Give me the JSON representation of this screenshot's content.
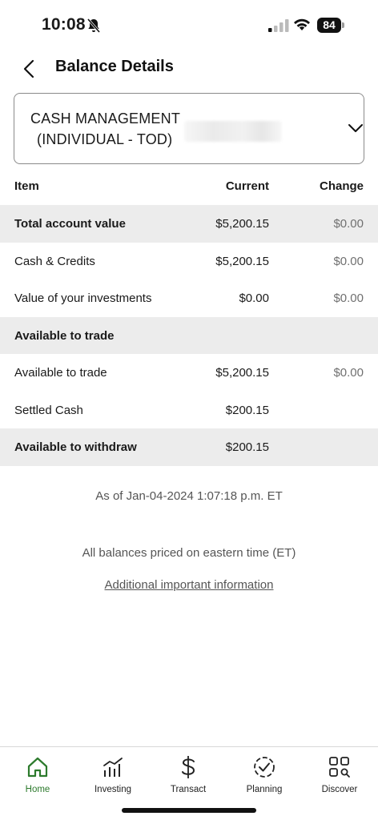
{
  "status_bar": {
    "time": "10:08",
    "battery": "84"
  },
  "header": {
    "title": "Balance Details"
  },
  "account": {
    "line1": "CASH MANAGEMENT",
    "line2": "(INDIVIDUAL - TOD)"
  },
  "table": {
    "headers": {
      "item": "Item",
      "current": "Current",
      "change": "Change"
    },
    "rows": [
      {
        "item": "Total account value",
        "current": "$5,200.15",
        "change": "$0.00"
      },
      {
        "item": "Cash & Credits",
        "current": "$5,200.15",
        "change": "$0.00"
      },
      {
        "item": "Value of your investments",
        "current": "$0.00",
        "change": "$0.00"
      },
      {
        "item": "Available to trade",
        "current": "",
        "change": ""
      },
      {
        "item": "Available to trade",
        "current": "$5,200.15",
        "change": "$0.00"
      },
      {
        "item": "Settled Cash",
        "current": "$200.15",
        "change": ""
      },
      {
        "item": "Available to withdraw",
        "current": "$200.15",
        "change": ""
      }
    ]
  },
  "footer": {
    "as_of": "As of Jan-04-2024 1:07:18 p.m. ET",
    "eastern_note": "All balances priced on eastern time (ET)",
    "additional_link": "Additional important information"
  },
  "nav": {
    "home": "Home",
    "investing": "Investing",
    "transact": "Transact",
    "planning": "Planning",
    "discover": "Discover"
  },
  "colors": {
    "active_nav": "#2c7a2c",
    "shaded_row": "#ececec"
  }
}
